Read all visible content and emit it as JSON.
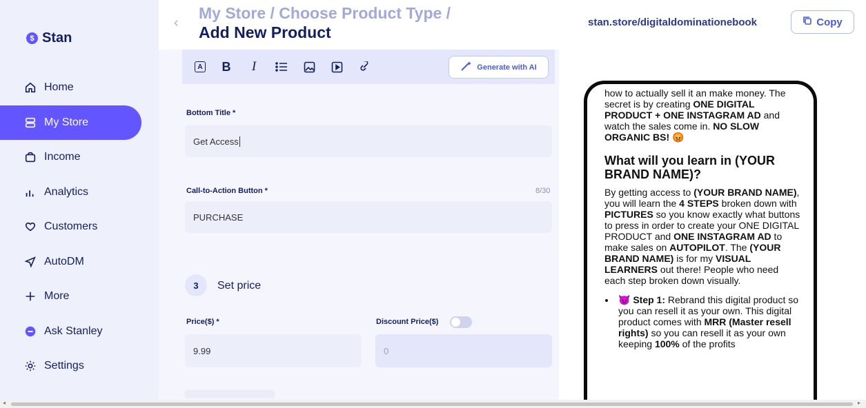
{
  "app": {
    "name": "Stan"
  },
  "nav": [
    {
      "label": "Home",
      "icon": "home-icon",
      "active": false
    },
    {
      "label": "My Store",
      "icon": "store-icon",
      "active": true
    },
    {
      "label": "Income",
      "icon": "wallet-icon",
      "active": false
    },
    {
      "label": "Analytics",
      "icon": "bar-chart-icon",
      "active": false
    },
    {
      "label": "Customers",
      "icon": "heart-icon",
      "active": false
    },
    {
      "label": "AutoDM",
      "icon": "send-icon",
      "active": false
    },
    {
      "label": "More",
      "icon": "plus-icon",
      "active": false
    },
    {
      "label": "Ask Stanley",
      "icon": "stanley-icon",
      "active": false
    },
    {
      "label": "Settings",
      "icon": "gear-icon",
      "active": false
    }
  ],
  "header": {
    "breadcrumb": "My Store / Choose Product Type /",
    "title": "Add New Product",
    "store_url": "stan.store/digitaldominationebook",
    "copy_label": "Copy"
  },
  "toolbar": {
    "generate_label": "Generate with AI"
  },
  "form": {
    "bottom_title_label": "Bottom Title *",
    "bottom_title_value": "Get Access",
    "cta_label": "Call-to-Action Button *",
    "cta_value": "PURCHASE",
    "cta_counter": "8/30",
    "step_number": "3",
    "step_title": "Set price",
    "price_label": "Price($) *",
    "price_value": "9.99",
    "discount_label": "Discount Price($)",
    "discount_value": "0",
    "discount_enabled": false
  },
  "preview": {
    "intro_a": "how to actually sell it an make money. The secret is by creating ",
    "intro_b": "ONE DIGITAL PRODUCT + ONE INSTAGRAM AD",
    "intro_c": " and watch the sales come in. ",
    "intro_d": "NO SLOW ORGANIC BS!",
    "intro_emoji": "😡",
    "heading": "What will you learn in (YOUR BRAND NAME)?",
    "p2_a": "By getting access to ",
    "p2_b": "(YOUR BRAND NAME)",
    "p2_c": ", you will learn the ",
    "p2_d": "4 STEPS",
    "p2_e": " broken down with ",
    "p2_f": "PICTURES",
    "p2_g": " so you know exactly what buttons to press in order to create your ONE DIGITAL PRODUCT and ",
    "p2_h": "ONE INSTAGRAM AD",
    "p2_i": " to make sales on ",
    "p2_j": "AUTOPILOT",
    "p2_k": ". The ",
    "p2_l": "(YOUR BRAND NAME)",
    "p2_m": " is for my ",
    "p2_n": "VISUAL LEARNERS",
    "p2_o": " out there! People who need each step broken down visually.",
    "step1_emoji": "😈",
    "step1_a": "Step 1:",
    "step1_b": " Rebrand this digital product so you can resell it as your own. This digital product comes with ",
    "step1_c": "MRR (Master resell rights)",
    "step1_d": " so you can resell it as your own keeping ",
    "step1_e": "100%",
    "step1_f": " of the profits"
  }
}
